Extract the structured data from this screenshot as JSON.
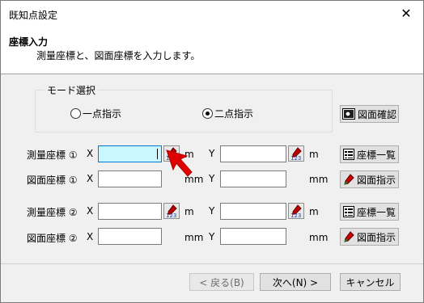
{
  "window": {
    "title": "既知点設定",
    "close_symbol": "✕"
  },
  "header": {
    "title": "座標入力",
    "description": "測量座標と、図面座標を入力します。"
  },
  "mode_group": {
    "legend": "モード選択",
    "options": [
      {
        "label": "一点指示",
        "checked": false
      },
      {
        "label": "二点指示",
        "checked": true
      }
    ],
    "confirm_button": "図面確認"
  },
  "rows": [
    {
      "label": "測量座標 ①",
      "x_label": "X",
      "x_unit": "m",
      "y_label": "Y",
      "y_unit": "m",
      "x_value": "",
      "y_value": "",
      "button": "座標一覧",
      "button_icon": "list-icon",
      "active": true
    },
    {
      "label": "図面座標 ①",
      "x_label": "X",
      "x_unit": "mm",
      "y_label": "Y",
      "y_unit": "mm",
      "x_value": "",
      "y_value": "",
      "button": "図面指示",
      "button_icon": "pick-icon"
    },
    {
      "label": "測量座標 ②",
      "x_label": "X",
      "x_unit": "m",
      "y_label": "Y",
      "y_unit": "m",
      "x_value": "",
      "y_value": "",
      "button": "座標一覧",
      "button_icon": "list-icon"
    },
    {
      "label": "図面座標 ②",
      "x_label": "X",
      "x_unit": "mm",
      "y_label": "Y",
      "y_unit": "mm",
      "x_value": "",
      "y_value": "",
      "button": "図面指示",
      "button_icon": "pick-icon"
    }
  ],
  "picker_badge": "123",
  "footer": {
    "back": "< 戻る(B)",
    "next": "次へ(N) >",
    "cancel": "キャンセル"
  }
}
